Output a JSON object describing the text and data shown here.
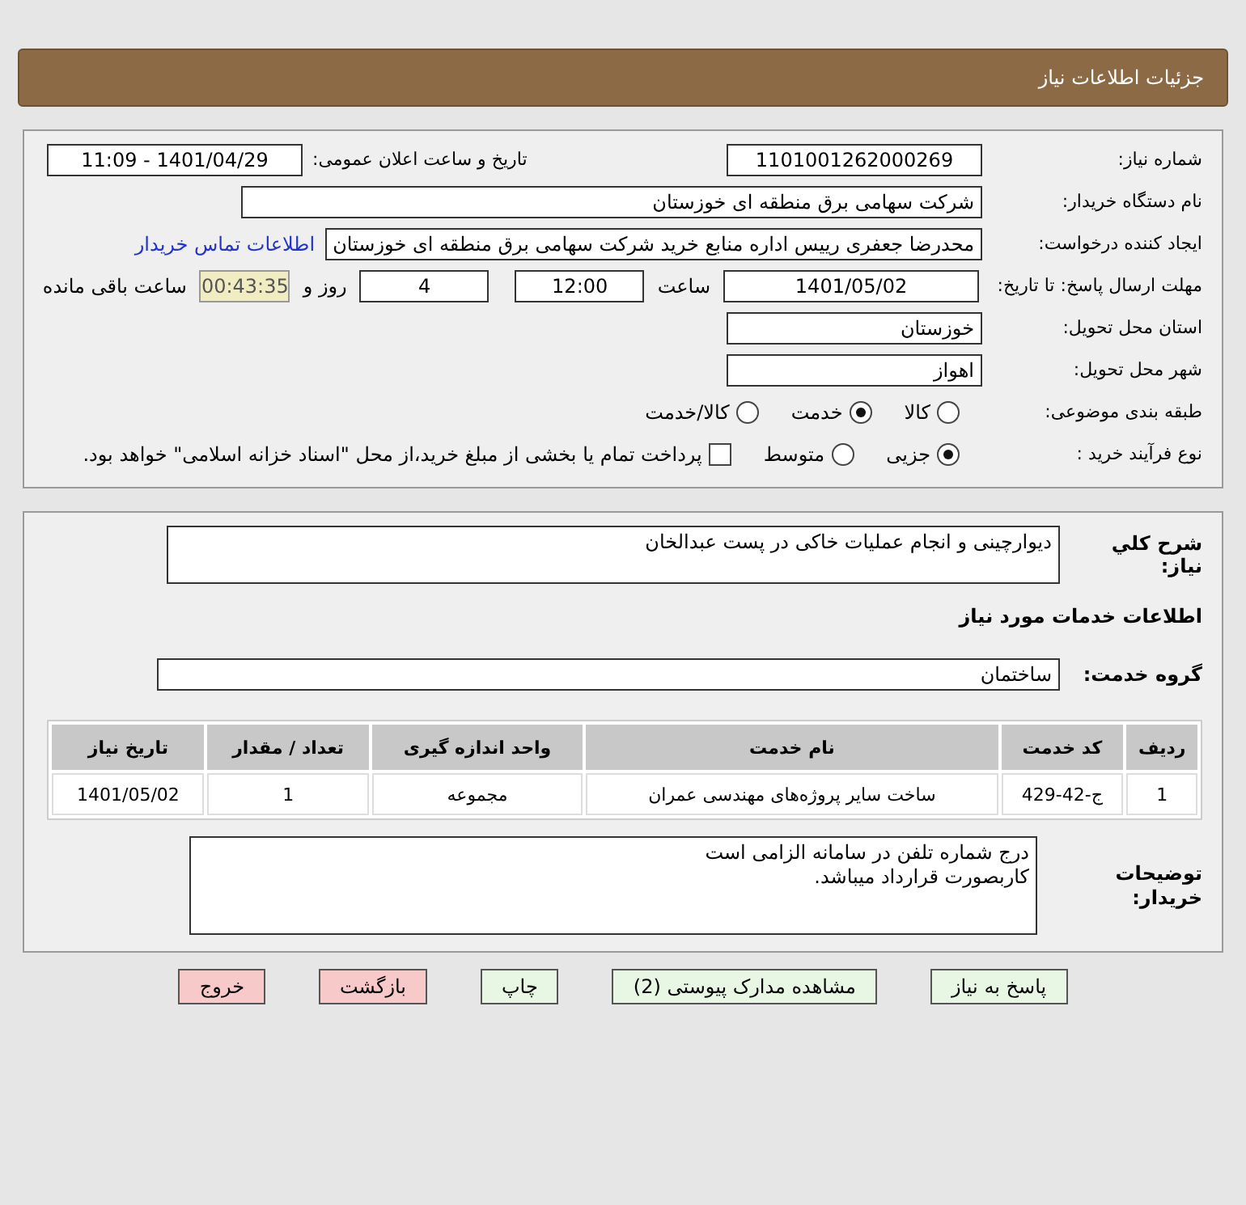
{
  "header": {
    "title": "جزئیات اطلاعات نیاز"
  },
  "details": {
    "need_number": {
      "label": "شماره نیاز:",
      "value": "1101001262000269"
    },
    "announce": {
      "label": "تاریخ و ساعت اعلان عمومی:",
      "value": "1401/04/29 - 11:09"
    },
    "buyer": {
      "label": "نام دستگاه خریدار:",
      "value": "شرکت سهامی برق منطقه ای خوزستان"
    },
    "creator": {
      "label": "ایجاد کننده درخواست:",
      "value": "محدرضا جعفری رییس اداره منابع خرید شرکت سهامی برق منطقه ای خوزستان",
      "link": "اطلاعات تماس خریدار"
    },
    "deadline": {
      "label": "مهلت ارسال پاسخ: تا تاریخ:",
      "date": "1401/05/02",
      "time_label": "ساعت",
      "time": "12:00",
      "days": "4",
      "days_label": "روز و",
      "remaining": "00:43:35",
      "remaining_label": "ساعت باقی مانده"
    },
    "province": {
      "label": "استان محل تحویل:",
      "value": "خوزستان"
    },
    "city": {
      "label": "شهر محل تحویل:",
      "value": "اهواز"
    },
    "category": {
      "label": "طبقه بندی موضوعی:",
      "options": [
        {
          "label": "کالا",
          "selected": false
        },
        {
          "label": "خدمت",
          "selected": true
        },
        {
          "label": "کالا/خدمت",
          "selected": false
        }
      ]
    },
    "process": {
      "label": "نوع فرآیند خرید :",
      "options": [
        {
          "label": "جزیی",
          "selected": true
        },
        {
          "label": "متوسط",
          "selected": false
        }
      ],
      "treasury": {
        "label": "پرداخت تمام یا بخشی از مبلغ خرید،از محل \"اسناد خزانه اسلامی\" خواهد بود.",
        "checked": false
      }
    }
  },
  "summary": {
    "label": "شرح کلي نياز:",
    "value": "دیوارچینی و انجام عملیات خاکی در پست عبدالخان"
  },
  "services_heading": "اطلاعات خدمات مورد نیاز",
  "service_group": {
    "label": "گروه خدمت:",
    "value": "ساختمان"
  },
  "table": {
    "columns": [
      "ردیف",
      "کد خدمت",
      "نام خدمت",
      "واحد اندازه گیری",
      "تعداد / مقدار",
      "تاریخ نیاز"
    ],
    "rows": [
      [
        "1",
        "ج-42-429",
        "ساخت سایر پروژه‌های مهندسی عمران",
        "مجموعه",
        "1",
        "1401/05/02"
      ]
    ]
  },
  "notes": {
    "label": "توضیحات خریدار:",
    "lines": [
      "درج شماره تلفن در سامانه الزامی است",
      "کاربصورت قرارداد میباشد."
    ]
  },
  "buttons": [
    {
      "label": "پاسخ به نیاز",
      "kind": "normal"
    },
    {
      "label": "مشاهده مدارک پیوستی (2)",
      "kind": "normal"
    },
    {
      "label": "چاپ",
      "kind": "normal"
    },
    {
      "label": "بازگشت",
      "kind": "exit"
    },
    {
      "label": "خروج",
      "kind": "exit"
    }
  ]
}
